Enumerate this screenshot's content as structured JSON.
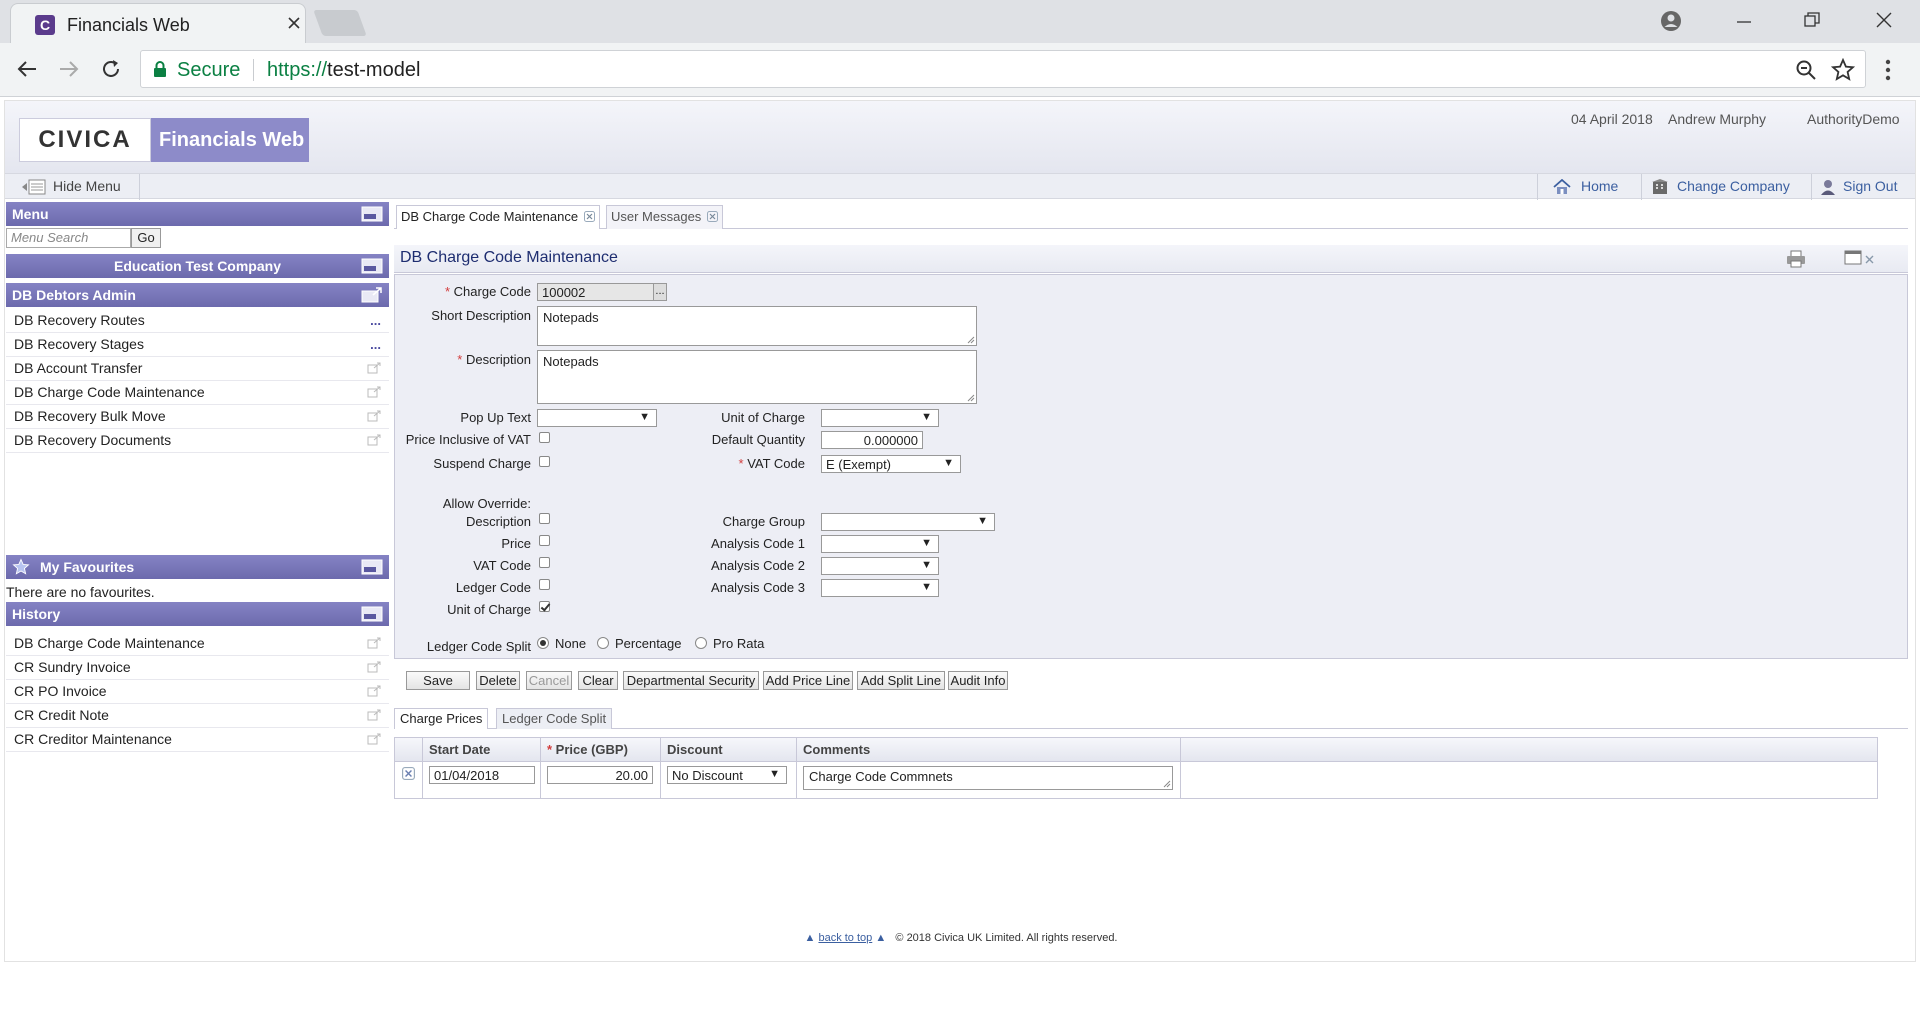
{
  "browser": {
    "tab_title": "Financials Web",
    "favicon_letter": "C",
    "secure_label": "Secure",
    "url_scheme": "https://",
    "url_host": "test-model"
  },
  "header": {
    "logo_text": "CIVICA",
    "app_name": "Financials Web",
    "date": "04 April 2018",
    "user": "Andrew Murphy",
    "authority": "AuthorityDemo"
  },
  "toolbar": {
    "hide_menu": "Hide Menu",
    "home": "Home",
    "change_company": "Change Company",
    "sign_out": "Sign Out"
  },
  "sidebar": {
    "menu_title": "Menu",
    "search_placeholder": "Menu Search",
    "go_label": "Go",
    "company": "Education Test Company",
    "module": "DB Debtors Admin",
    "items": [
      {
        "label": "DB Recovery Routes"
      },
      {
        "label": "DB Recovery Stages"
      },
      {
        "label": "DB Account Transfer"
      },
      {
        "label": "DB Charge Code Maintenance"
      },
      {
        "label": "DB Recovery Bulk Move"
      },
      {
        "label": "DB Recovery Documents"
      }
    ],
    "favourites_title": "My Favourites",
    "no_favourites": "There are no favourites.",
    "history_title": "History",
    "history": [
      {
        "label": "DB Charge Code Maintenance"
      },
      {
        "label": "CR Sundry Invoice"
      },
      {
        "label": "CR PO Invoice"
      },
      {
        "label": "CR Credit Note"
      },
      {
        "label": "CR Creditor Maintenance"
      }
    ]
  },
  "content_tabs": {
    "tab1": "DB Charge Code Maintenance",
    "tab2": "User Messages"
  },
  "form": {
    "title": "DB Charge Code Maintenance",
    "charge_code_label": "Charge Code",
    "charge_code_value": "100002",
    "short_desc_label": "Short Description",
    "short_desc_value": "Notepads",
    "desc_label": "Description",
    "desc_value": "Notepads",
    "popup_text_label": "Pop Up Text",
    "popup_text_value": "",
    "price_incl_vat_label": "Price Inclusive of VAT",
    "suspend_label": "Suspend Charge",
    "unit_charge_label": "Unit of Charge",
    "unit_charge_value": "",
    "default_qty_label": "Default Quantity",
    "default_qty_value": "0.000000",
    "vat_code_label": "VAT Code",
    "vat_code_value": "E (Exempt)",
    "allow_override_label": "Allow Override:",
    "ov_description": "Description",
    "ov_price": "Price",
    "ov_vat": "VAT Code",
    "ov_ledger": "Ledger Code",
    "ov_unit": "Unit of Charge",
    "charge_group_label": "Charge Group",
    "charge_group_value": "",
    "analysis1_label": "Analysis Code 1",
    "analysis2_label": "Analysis Code 2",
    "analysis3_label": "Analysis Code 3",
    "ledger_split_label": "Ledger Code Split",
    "split_none": "None",
    "split_percentage": "Percentage",
    "split_prorata": "Pro Rata"
  },
  "buttons": {
    "save": "Save",
    "delete": "Delete",
    "cancel": "Cancel",
    "clear": "Clear",
    "dept_security": "Departmental Security",
    "add_price_line": "Add Price Line",
    "add_split_line": "Add Split Line",
    "audit_info": "Audit Info"
  },
  "subtabs": {
    "charge_prices": "Charge Prices",
    "ledger_code_split": "Ledger Code Split"
  },
  "grid": {
    "col_start_date": "Start Date",
    "col_price": "Price (GBP)",
    "col_discount": "Discount",
    "col_comments": "Comments",
    "row": {
      "start_date": "01/04/2018",
      "price": "20.00",
      "discount": "No Discount",
      "comments": "Charge Code Commnets"
    }
  },
  "footer": {
    "back_to_top": "back to top",
    "copyright": "© 2018 Civica UK Limited. All rights reserved."
  },
  "colors": {
    "panel_header": "#7573b8",
    "brand_purple": "#5b3b8c",
    "secure_green": "#0b8043"
  }
}
